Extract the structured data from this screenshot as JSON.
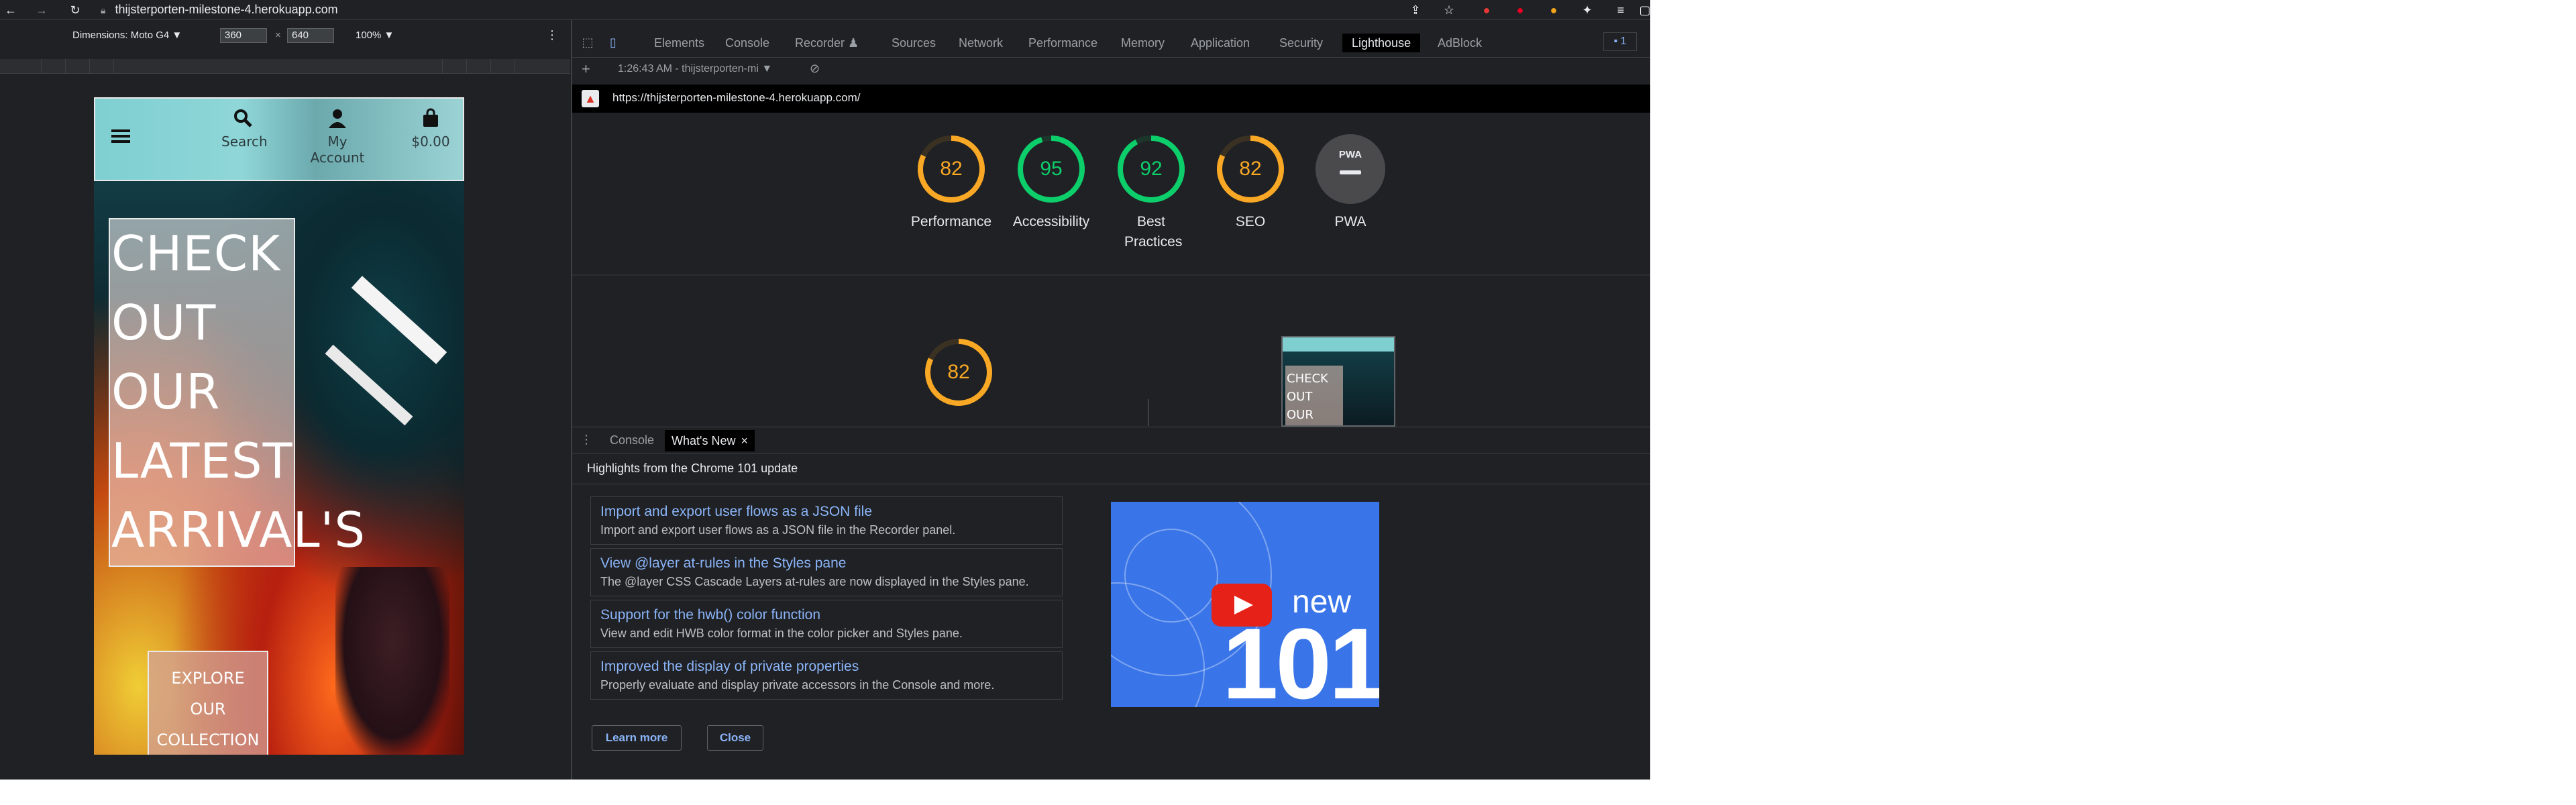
{
  "browser": {
    "url": "thijsterporten-milestone-4.herokuapp.com",
    "icons": [
      "back-icon",
      "forward-icon",
      "reload-icon",
      "lock-icon",
      "share-icon",
      "star-icon",
      "extension-icon",
      "pinterest-icon",
      "grammarly-icon",
      "puzzle-icon",
      "reading-list-icon",
      "window-icon"
    ]
  },
  "device_toolbar": {
    "dimensions_label": "Dimensions: Moto G4 ▼",
    "width": "360",
    "times": "×",
    "height": "640",
    "zoom": "100% ▼"
  },
  "site": {
    "header": {
      "search_label": "Search",
      "account_label": "My Account",
      "cart_label": "$0.00"
    },
    "hero_lines": [
      "CHECK",
      "OUT",
      "OUR",
      "LATEST",
      "ARRIVAL'S"
    ],
    "cta_lines": [
      "EXPLORE",
      "OUR",
      "COLLECTION"
    ]
  },
  "devtools": {
    "tabs": [
      "Elements",
      "Console",
      "Recorder ♟",
      "Sources",
      "Network",
      "Performance",
      "Memory",
      "Application",
      "Security",
      "Lighthouse",
      "AdBlock"
    ],
    "active_tab": "Lighthouse",
    "issues_badge": "1",
    "session_label": "1:26:43 AM - thijsterporten-mi ▼",
    "report_url": "https://thijsterporten-milestone-4.herokuapp.com/",
    "scores": [
      {
        "label": "Performance",
        "value": 82,
        "color": "#f9a825"
      },
      {
        "label": "Accessibility",
        "value": 95,
        "color": "#0cce6b"
      },
      {
        "label": "Best Practices",
        "value": 92,
        "color": "#0cce6b"
      },
      {
        "label": "SEO",
        "value": 82,
        "color": "#f9a825"
      }
    ],
    "pwa": {
      "label": "PWA",
      "badge": "PWA"
    },
    "detail_score": {
      "value": 82,
      "color": "#f9a825"
    },
    "thumb_lines": [
      "CHECK",
      "OUT",
      "OUR"
    ]
  },
  "drawer": {
    "tabs": [
      "Console",
      "What's New"
    ],
    "active_tab": "What's New",
    "close": "×",
    "heading": "Highlights from the Chrome 101 update",
    "features": [
      {
        "title": "Import and export user flows as a JSON file",
        "desc": "Import and export user flows as a JSON file in the Recorder panel."
      },
      {
        "title": "View @layer at-rules in the Styles pane",
        "desc": "The @layer CSS Cascade Layers at-rules are now displayed in the Styles pane."
      },
      {
        "title": "Support for the hwb() color function",
        "desc": "View and edit HWB color format in the color picker and Styles pane."
      },
      {
        "title": "Improved the display of private properties",
        "desc": "Properly evaluate and display private accessors in the Console and more."
      }
    ],
    "video": {
      "new": "new",
      "version": "101"
    },
    "learn_more": "Learn more",
    "close_label": "Close"
  }
}
